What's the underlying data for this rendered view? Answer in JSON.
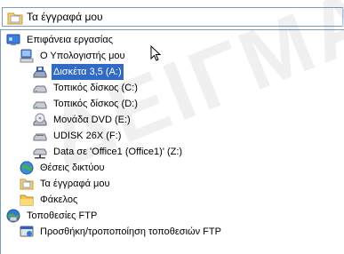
{
  "combo": {
    "value": "Τα έγγραφά μου",
    "icon": "my-documents-folder-icon"
  },
  "tree": [
    {
      "label": "Επιφάνεια εργασίας",
      "icon": "desktop-icon"
    },
    {
      "label": "Ο Υπολογιστής μου",
      "icon": "my-computer-icon"
    },
    {
      "label": "Δισκέτα 3,5 (A:)",
      "icon": "floppy-drive-icon",
      "selected": true
    },
    {
      "label": "Τοπικός δίσκος (C:)",
      "icon": "hard-disk-icon"
    },
    {
      "label": "Τοπικός δίσκος (D:)",
      "icon": "hard-disk-icon"
    },
    {
      "label": "Μονάδα DVD (E:)",
      "icon": "dvd-drive-icon"
    },
    {
      "label": "UDISK 26X (F:)",
      "icon": "removable-disk-icon"
    },
    {
      "label": "Data σε 'Office1 (Office1)' (Z:)",
      "icon": "network-drive-icon"
    },
    {
      "label": "Θέσεις δικτύου",
      "icon": "network-places-icon"
    },
    {
      "label": "Τα έγγραφά μου",
      "icon": "my-documents-folder-icon"
    },
    {
      "label": "Φάκελος",
      "icon": "folder-icon"
    },
    {
      "label": "Τοποθεσίες FTP",
      "icon": "ftp-locations-icon"
    },
    {
      "label": "Προσθήκη/τροποποίηση τοποθεσιών FTP",
      "icon": "ftp-add-icon"
    }
  ],
  "watermark": "ΔΕΙΓΜΑ ΣΕΝΤΟΜΟΣ"
}
